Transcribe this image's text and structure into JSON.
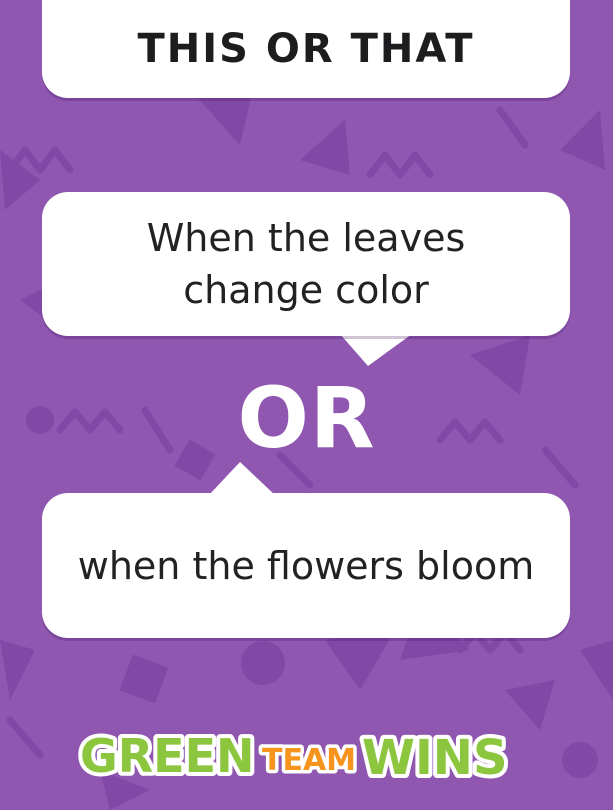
{
  "title": "THIS OR THAT",
  "option_a": "When the leaves change color",
  "option_b": "when the flowers bloom",
  "divider": "OR",
  "logo": {
    "green": "GREEN",
    "team": "TEAM",
    "wins": "WINS"
  },
  "colors": {
    "background": "#8f57b0",
    "pattern": "#7f45a2",
    "bubble": "#ffffff",
    "text": "#222222",
    "logo_green": "#8cc63f",
    "logo_orange": "#f7941d"
  }
}
